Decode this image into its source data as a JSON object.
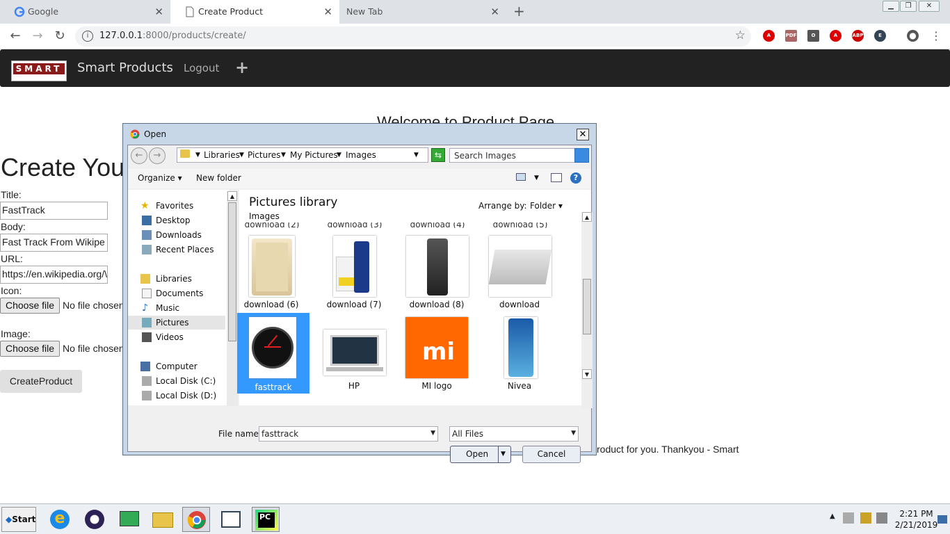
{
  "browser": {
    "tabs": [
      {
        "label": "Google",
        "active": false
      },
      {
        "label": "Create Product",
        "active": true
      },
      {
        "label": "New Tab",
        "active": false
      }
    ],
    "url_host": "127.0.0.1",
    "url_rest": ":8000/products/create/",
    "extensions": [
      "A",
      "PDF",
      "O",
      "A",
      "ABP",
      "E"
    ]
  },
  "site": {
    "logo_text": "SMART",
    "brand": "Smart Products",
    "logout": "Logout",
    "plus": "+"
  },
  "page": {
    "welcome": "Welcome to Product Page",
    "heading": "Create You",
    "title_label": "Title:",
    "title_value": "FastTrack",
    "body_label": "Body:",
    "body_value": "Fast Track From Wikipe",
    "url_label": "URL:",
    "url_value": "https://en.wikipedia.org/\\",
    "icon_label": "Icon:",
    "image_label": "Image:",
    "choose_file": "Choose file",
    "no_file": "No file chosen",
    "create_button": "CreateProduct",
    "footer": "roduct for you. Thankyou - Smart"
  },
  "dialog": {
    "title": "Open",
    "breadcrumb": [
      "Libraries",
      "Pictures",
      "My Pictures",
      "Images"
    ],
    "search_placeholder": "Search Images",
    "organize": "Organize",
    "new_folder": "New folder",
    "sidebar": {
      "favorites": "Favorites",
      "desktop": "Desktop",
      "downloads": "Downloads",
      "recent": "Recent Places",
      "libraries": "Libraries",
      "documents": "Documents",
      "music": "Music",
      "pictures": "Pictures",
      "videos": "Videos",
      "computer": "Computer",
      "disk_c": "Local Disk (C:)",
      "disk_d": "Local Disk (D:)"
    },
    "library_title": "Pictures library",
    "library_sub": "Images",
    "arrange_by": "Arrange by:",
    "arrange_value": "Folder",
    "cut_labels": [
      "download (2)",
      "download (3)",
      "download (4)",
      "download (5)"
    ],
    "files": [
      {
        "name": "download (6)",
        "thumb": "phone"
      },
      {
        "name": "download (7)",
        "thumb": "nivea-men"
      },
      {
        "name": "download (8)",
        "thumb": "dove"
      },
      {
        "name": "download",
        "thumb": "laptop"
      },
      {
        "name": "fasttrack",
        "thumb": "watch",
        "selected": true
      },
      {
        "name": "HP",
        "thumb": "hp-laptop"
      },
      {
        "name": "MI logo",
        "thumb": "mi"
      },
      {
        "name": "Nivea",
        "thumb": "nivea"
      }
    ],
    "file_name_label": "File name:",
    "file_name_value": "fasttrack",
    "file_type": "All Files",
    "open_button": "Open",
    "cancel_button": "Cancel"
  },
  "taskbar": {
    "start": "Start",
    "time": "2:21 PM",
    "date": "2/21/2019"
  }
}
